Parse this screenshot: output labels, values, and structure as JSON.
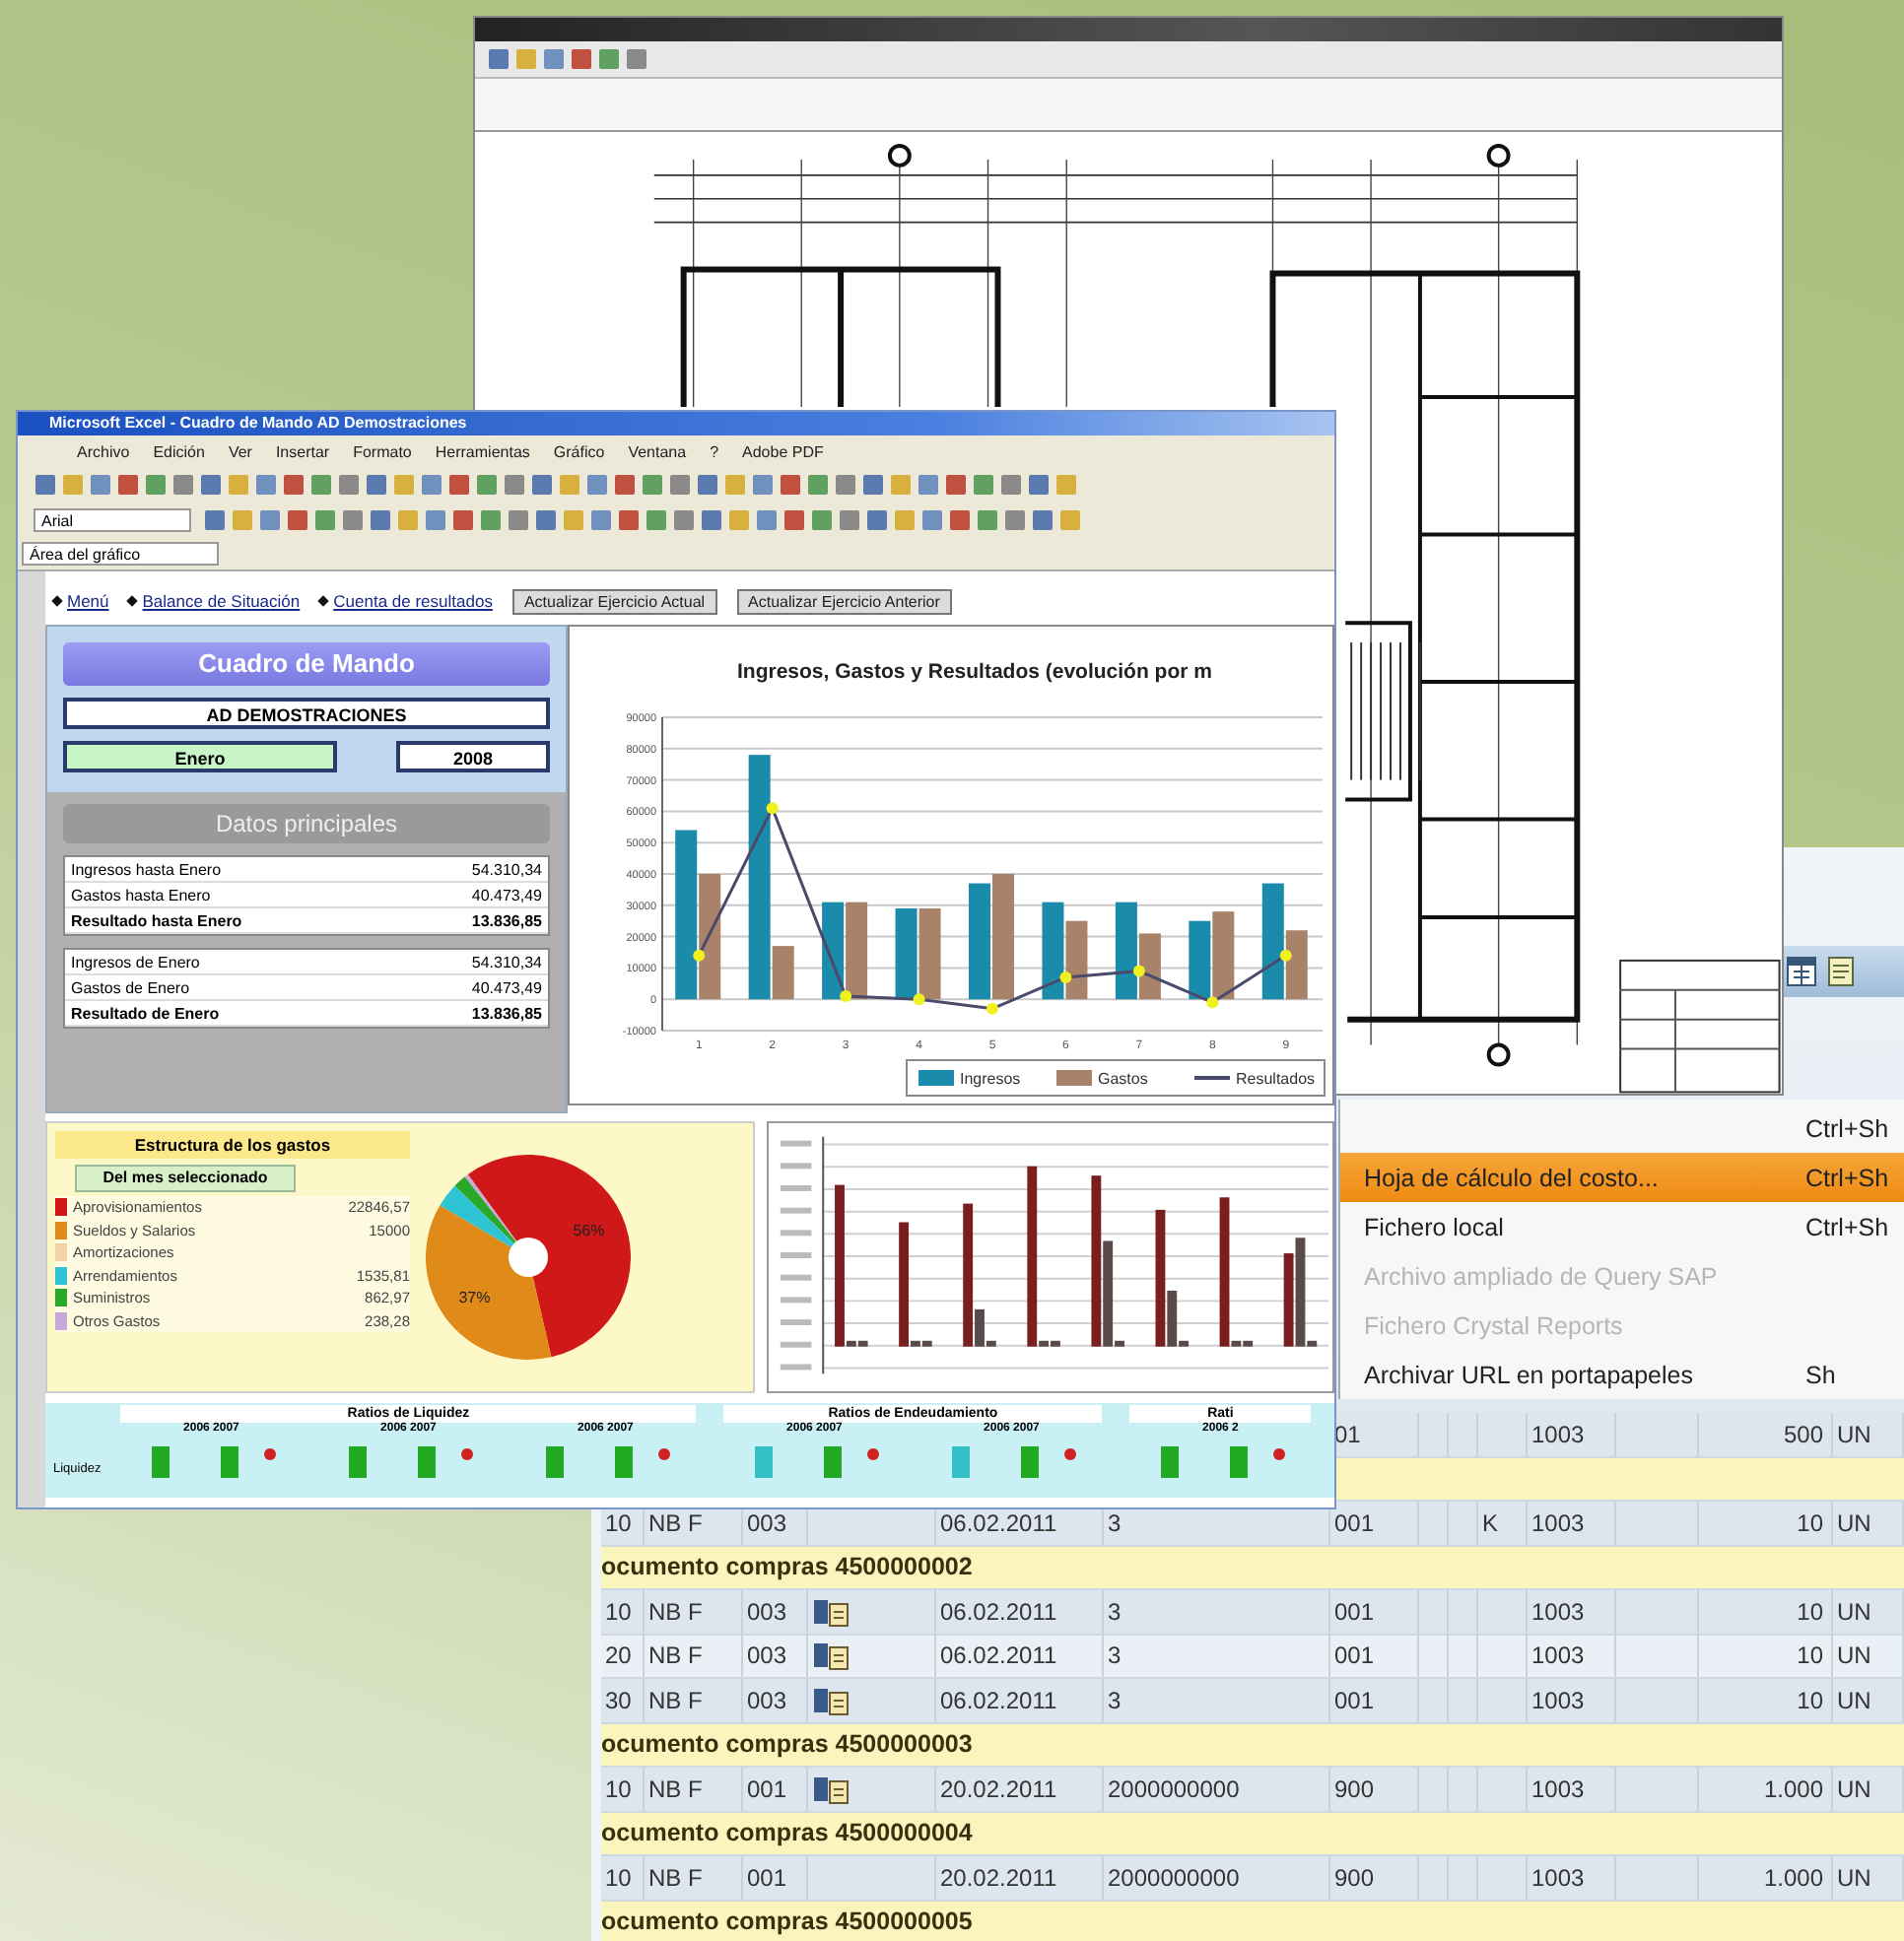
{
  "excel": {
    "title": "Microsoft Excel - Cuadro de Mando AD Demostraciones",
    "menu": [
      "Archivo",
      "Edición",
      "Ver",
      "Insertar",
      "Formato",
      "Herramientas",
      "Gráfico",
      "Ventana",
      "?",
      "Adobe PDF"
    ],
    "font_field": "Arial",
    "name_box": "Área del gráfico",
    "nav_links": [
      "Menú",
      "Balance de Situación",
      "Cuenta de resultados"
    ],
    "nav_buttons": [
      "Actualizar Ejercicio Actual",
      "Actualizar Ejercicio Anterior"
    ],
    "dashboard": {
      "title": "Cuadro de Mando",
      "company": "AD DEMOSTRACIONES",
      "month": "Enero",
      "year": "2008"
    },
    "main_data": {
      "title": "Datos principales",
      "groups": [
        [
          {
            "label": "Ingresos hasta Enero",
            "value": "54.310,34",
            "total": false
          },
          {
            "label": "Gastos hasta Enero",
            "value": "40.473,49",
            "total": false
          },
          {
            "label": "Resultado hasta Enero",
            "value": "13.836,85",
            "total": true
          }
        ],
        [
          {
            "label": "Ingresos de Enero",
            "value": "54.310,34",
            "total": false
          },
          {
            "label": "Gastos de Enero",
            "value": "40.473,49",
            "total": false
          },
          {
            "label": "Resultado de Enero",
            "value": "13.836,85",
            "total": true
          }
        ]
      ]
    },
    "chart_data": {
      "type": "bar",
      "title": "Ingresos, Gastos y Resultados (evolución por m",
      "categories": [
        "1",
        "2",
        "3",
        "4",
        "5",
        "6",
        "7",
        "8",
        "9"
      ],
      "series": [
        {
          "name": "Ingresos",
          "type": "bar",
          "color": "#1b8bab",
          "values": [
            54000,
            78000,
            31000,
            29000,
            37000,
            31000,
            31000,
            25000,
            37000
          ]
        },
        {
          "name": "Gastos",
          "type": "bar",
          "color": "#a8836a",
          "values": [
            40000,
            17000,
            31000,
            29000,
            40000,
            25000,
            21000,
            28000,
            22000
          ]
        },
        {
          "name": "Resultados",
          "type": "line",
          "marker": "circle",
          "color": "#4a4a6a",
          "values": [
            14000,
            61000,
            1000,
            0,
            -3000,
            7000,
            9000,
            -1000,
            14000
          ]
        }
      ],
      "grid": true,
      "legend": true,
      "ylim": [
        -10000,
        90000
      ],
      "yticks": [
        -10000,
        0,
        10000,
        20000,
        30000,
        40000,
        50000,
        60000,
        70000,
        80000,
        90000
      ]
    },
    "expenses": {
      "title": "Estructura de los gastos",
      "tab": "Del mes seleccionado",
      "items": [
        {
          "value": "22846,57",
          "color": "#d01818"
        },
        {
          "value": "15000",
          "color": "#e08a1a"
        },
        {
          "color": "#f2d3a8"
        },
        {
          "value": "1535,81",
          "color": "#2fc4d4"
        },
        {
          "value": "862,97",
          "color": "#2aa82a"
        },
        {
          "value": "238,28",
          "color": "#c8a8d8"
        }
      ],
      "chart_data": {
        "type": "pie",
        "categories": [
          "Aprovisionamientos",
          "Sueldos y Salarios",
          "Amortizaciones",
          "Arrendamientos",
          "Suministros",
          "Otros Gastos"
        ],
        "values": [
          56.4,
          37.1,
          0,
          3.8,
          2.1,
          0.6
        ],
        "value_labels": [
          "56%",
          "37%",
          null,
          null,
          null,
          null
        ]
      }
    },
    "ratios": {
      "row_label": "Liquidez",
      "groups": [
        {
          "title": "Ratios de Liquidez",
          "years": [
            "2006 2007",
            "2006 2007",
            "2006 2007"
          ]
        },
        {
          "title": "Ratios de Endeudamiento",
          "years": [
            "2006 2007",
            "2006 2007"
          ]
        },
        {
          "title": "Rati",
          "years": [
            "2006 2"
          ]
        }
      ]
    }
  },
  "sap": {
    "menu": [
      {
        "shortcut": "Ctrl+Sh",
        "selected": false,
        "disabled": false
      },
      {
        "label": "Hoja de cálculo del costo...",
        "shortcut": "Ctrl+Sh",
        "selected": true,
        "disabled": false
      },
      {
        "label": "Fichero local",
        "shortcut": "Ctrl+Sh",
        "selected": false,
        "disabled": false
      },
      {
        "label": "Archivo ampliado de Query SAP",
        "selected": false,
        "disabled": true
      },
      {
        "label": "Fichero Crystal Reports",
        "selected": false,
        "disabled": true
      },
      {
        "label": "Archivar URL en portapapeles",
        "shortcut": "Sh",
        "selected": false,
        "disabled": false
      }
    ],
    "rows": [
      {
        "kind": "item",
        "attachment": false,
        "column_7": "01",
        "column_11": "1003",
        "column_13": "500",
        "column_14": "UN"
      },
      {
        "kind": "group"
      },
      {
        "kind": "item",
        "attachment": false,
        "column_1": "10",
        "column_2": "NB F",
        "column_3": "003",
        "column_5": "06.02.2011",
        "column_6": "3",
        "column_7": "001",
        "column_10": "K",
        "column_11": "1003",
        "column_13": "10",
        "column_14": "UN"
      },
      {
        "kind": "group",
        "text": "ocumento compras 4500000002"
      },
      {
        "kind": "item",
        "attachment": true,
        "column_1": "10",
        "column_2": "NB F",
        "column_3": "003",
        "column_5": "06.02.2011",
        "column_6": "3",
        "column_7": "001",
        "column_11": "1003",
        "column_13": "10",
        "column_14": "UN"
      },
      {
        "kind": "item",
        "attachment": true,
        "column_1": "20",
        "column_2": "NB F",
        "column_3": "003",
        "column_5": "06.02.2011",
        "column_6": "3",
        "column_7": "001",
        "column_11": "1003",
        "column_13": "10",
        "column_14": "UN"
      },
      {
        "kind": "item",
        "attachment": true,
        "column_1": "30",
        "column_2": "NB F",
        "column_3": "003",
        "column_5": "06.02.2011",
        "column_6": "3",
        "column_7": "001",
        "column_11": "1003",
        "column_13": "10",
        "column_14": "UN"
      },
      {
        "kind": "group",
        "text": "ocumento compras 4500000003"
      },
      {
        "kind": "item",
        "attachment": true,
        "column_1": "10",
        "column_2": "NB F",
        "column_3": "001",
        "column_5": "20.02.2011",
        "column_6": "2000000000",
        "column_7": "900",
        "column_11": "1003",
        "column_13": "1.000",
        "column_14": "UN"
      },
      {
        "kind": "group",
        "text": "ocumento compras 4500000004"
      },
      {
        "kind": "item",
        "attachment": false,
        "column_1": "10",
        "column_2": "NB F",
        "column_3": "001",
        "column_5": "20.02.2011",
        "column_6": "2000000000",
        "column_7": "900",
        "column_11": "1003",
        "column_13": "1.000",
        "column_14": "UN"
      },
      {
        "kind": "group",
        "text": "ocumento compras 4500000005"
      }
    ]
  }
}
